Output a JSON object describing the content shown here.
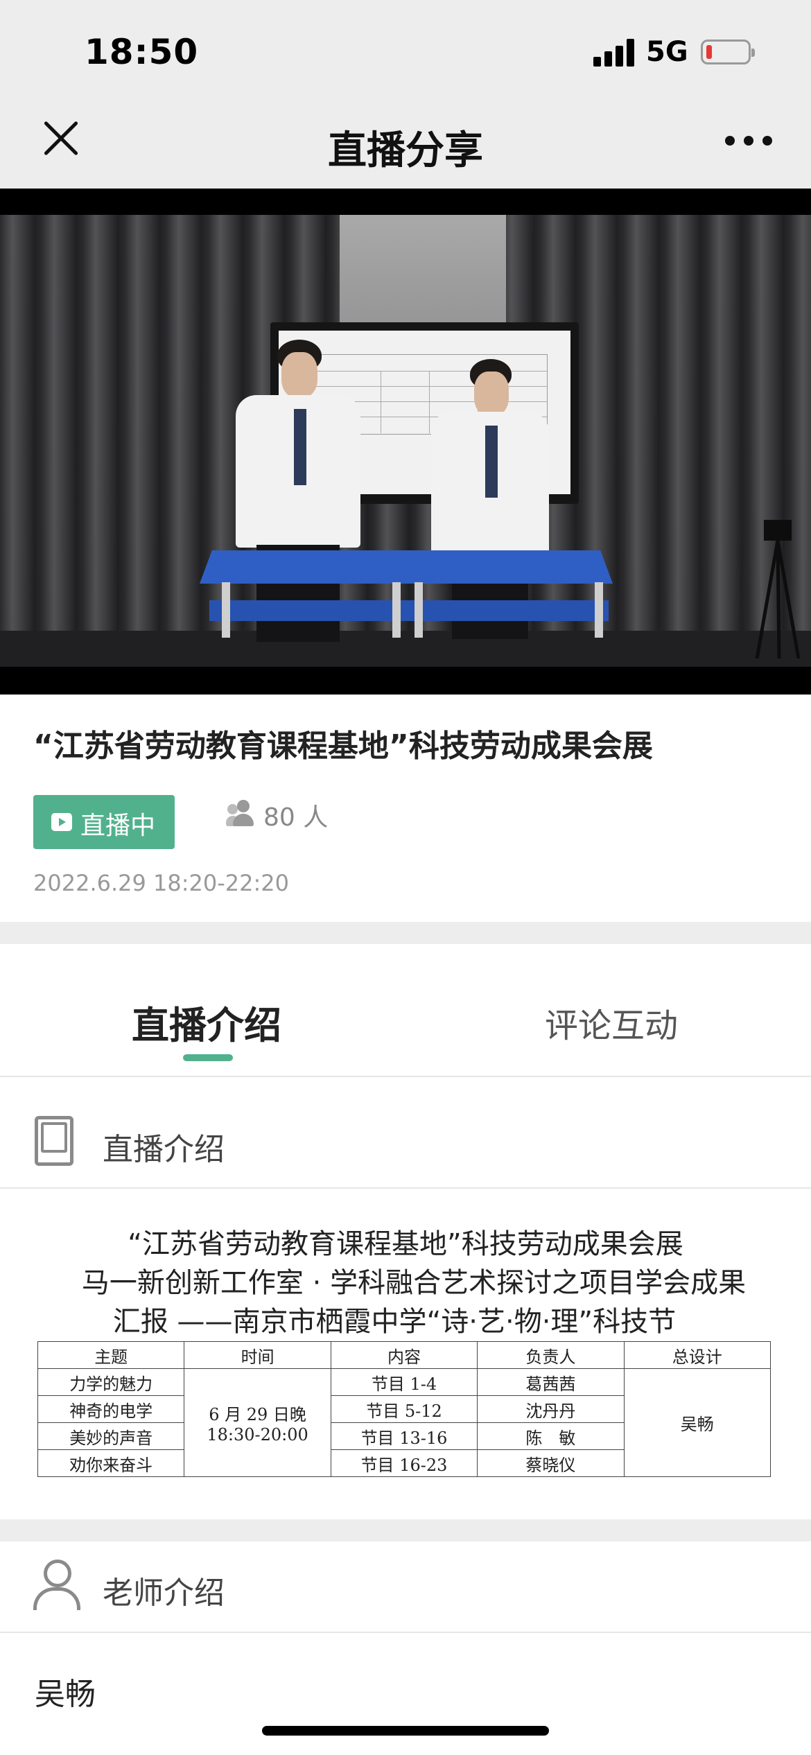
{
  "status": {
    "time": "18:50",
    "network": "5G"
  },
  "nav": {
    "title": "直播分享"
  },
  "broadcast": {
    "title": "“江苏省劳动教育课程基地”科技劳动成果会展",
    "status_label": "直播中",
    "viewers": "80 人",
    "time_range": "2022.6.29 18:20-22:20"
  },
  "tabs": [
    {
      "label": "直播介绍",
      "active": true
    },
    {
      "label": "评论互动",
      "active": false
    }
  ],
  "intro": {
    "section_title": "直播介绍",
    "lines": [
      "“江苏省劳动教育课程基地”科技劳动成果会展",
      "马一新创新工作室 · 学科融合艺术探讨之项目学会成果",
      "汇报 ——南京市栖霞中学“诗·艺·物·理”科技节"
    ],
    "table": {
      "headers": [
        "主题",
        "时间",
        "内容",
        "负责人",
        "总设计"
      ],
      "themes": [
        "力学的魅力",
        "神奇的电学",
        "美妙的声音",
        "劝你来奋斗"
      ],
      "time": [
        "6 月 29 日晚",
        "18:30-20:00"
      ],
      "contents": [
        "节目 1-4",
        "节目 5-12",
        "节目 13-16",
        "节目 16-23"
      ],
      "leads": [
        "葛茜茜",
        "沈丹丹",
        "陈　敏",
        "蔡晓仪"
      ],
      "designer": "吴畅"
    }
  },
  "teacher": {
    "section_title": "老师介绍",
    "name": "吴畅"
  },
  "colors": {
    "accent": "#52b18d",
    "background": "#ededed"
  }
}
